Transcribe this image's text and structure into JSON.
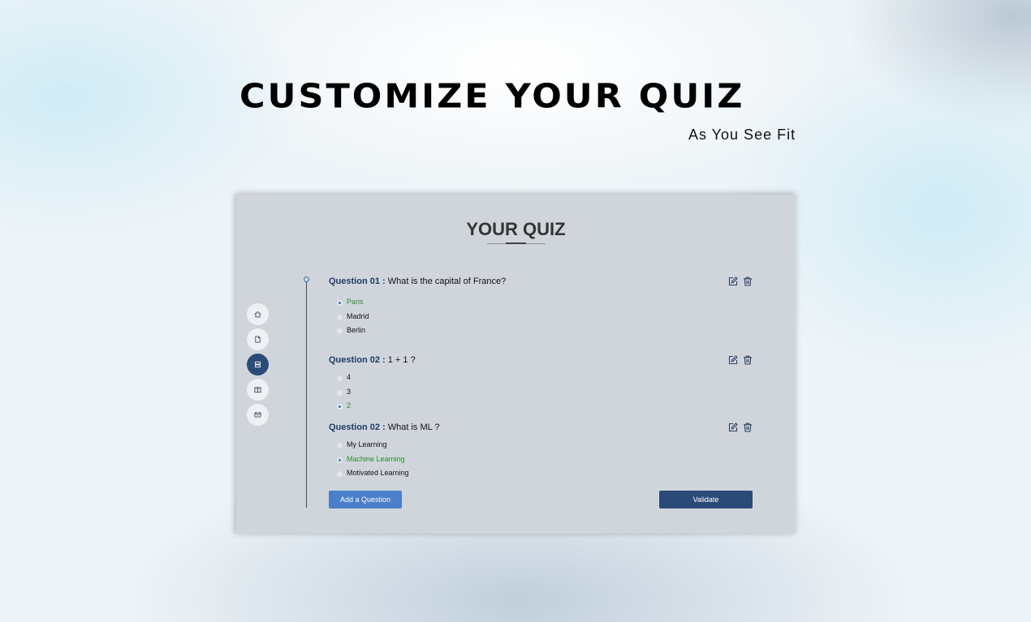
{
  "hero": {
    "title": "CUSTOMIZE YOUR QUIZ",
    "subtitle": "As You See Fit"
  },
  "panel": {
    "title": "YOUR QUIZ"
  },
  "sidebar": {
    "items": [
      {
        "icon": "home-icon",
        "active": false
      },
      {
        "icon": "document-icon",
        "active": false
      },
      {
        "icon": "database-icon",
        "active": true
      },
      {
        "icon": "book-icon",
        "active": false
      },
      {
        "icon": "mail-icon",
        "active": false
      }
    ]
  },
  "questions": [
    {
      "label": "Question 01 :",
      "text": " What is the capital of France?",
      "options": [
        {
          "text": "Paris",
          "correct": true
        },
        {
          "text": "Madrid",
          "correct": false
        },
        {
          "text": "Berlin",
          "correct": false
        }
      ]
    },
    {
      "label": "Question 02 :",
      "text": " 1 + 1 ?",
      "options": [
        {
          "text": "4",
          "correct": false
        },
        {
          "text": "3",
          "correct": false
        },
        {
          "text": "2",
          "correct": true
        }
      ]
    },
    {
      "label": "Question 02 :",
      "text": " What is ML ?",
      "options": [
        {
          "text": "My Learning",
          "correct": false
        },
        {
          "text": "Machine Learning",
          "correct": true
        },
        {
          "text": "Motivated Learning",
          "correct": false
        }
      ]
    }
  ],
  "buttons": {
    "add_question": "Add a Question",
    "validate": "Validate"
  },
  "colors": {
    "accent": "#2a4a78",
    "add_button": "#4a7fc9",
    "correct": "#2b8a2b",
    "question_label": "#1d3a66",
    "panel_bg": "#d0d5dc"
  }
}
